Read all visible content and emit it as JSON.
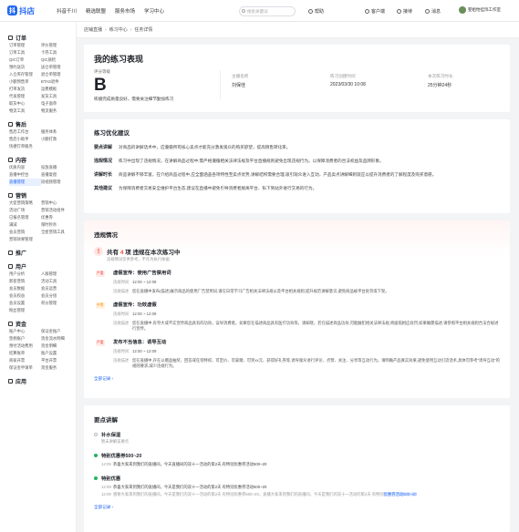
{
  "topbar": {
    "logo_text": "抖店",
    "nav": [
      "抖音千川",
      "精选联盟",
      "服务市场",
      "学习中心"
    ],
    "search_placeholder": "搜索关键词",
    "tools": [
      "帮助",
      "客户端",
      "接待",
      "消息"
    ],
    "user_name": "婴姐怡挂饰工作室"
  },
  "sidebar": [
    {
      "title": "订单",
      "items": [
        "订单管理",
        "评价管理",
        "订单工具",
        "卡券工具",
        "QIC订单",
        "QIC质检",
        "预约送货",
        "送仓单管理",
        "入仓库存管理",
        "退仓单管理",
        "小额预售单",
        "BTAS退件",
        "打单发货",
        "运费模板",
        "代发管理",
        "发货工具",
        "取货中心",
        "电子面单",
        "物流工具",
        "物流服务"
      ]
    },
    {
      "title": "售后",
      "items": [
        "售后工作台",
        "服务体系",
        "售后小助手",
        "小额打款",
        "快捷钉单服务"
      ]
    },
    {
      "title": "内容",
      "items": [
        "优质内容",
        "投放直播",
        "直播中控台",
        "直播复盘",
        "直播管理",
        "短视频管理"
      ]
    },
    {
      "title": "营销",
      "items": [
        "大促营销策略",
        "营销中心",
        "活动广场",
        "营销活动组件",
        "已报名管理",
        "优惠券",
        "满减",
        "限时秒杀",
        "会员营销",
        "全屋营销工具",
        "营销效果管理"
      ]
    },
    {
      "title": "推广",
      "items": []
    },
    {
      "title": "用户",
      "items": [
        "用户分析",
        "人群管理",
        "新客营销",
        "活动工具",
        "会员数据",
        "会员运营",
        "会员权益",
        "会员分组",
        "会员设置",
        "积分管理",
        "粉丝管理"
      ]
    },
    {
      "title": "资金",
      "items": [
        "账户中心",
        "保证金账户",
        "垫佣账户",
        "资金流水明细",
        "预付活动费用",
        "资金明细",
        "结算账单",
        "账户设置",
        "商家开票",
        "平台开票",
        "保证金申请单",
        "资金服务"
      ]
    },
    {
      "title": "应用",
      "items": []
    }
  ],
  "active_sidebar_item": "直播管理",
  "breadcrumb": [
    "店铺直播",
    "练习中心",
    "任务详情"
  ],
  "summary": {
    "title": "我的练习表现",
    "grade_label": "评分等级",
    "grade": "B",
    "grade_desc": "练播完成质量良好，需要关注细节勤加练习",
    "anchor_label": "主播名称",
    "anchor": "刘保佳",
    "time_label": "练习创建时间",
    "time": "2023/03/30 10:08",
    "duration_label": "本次练习时长",
    "duration": "25分钟24秒"
  },
  "suggestions": {
    "title": "练习优化建议",
    "items": [
      {
        "k": "要点讲解",
        "v": "对商品的讲解话术中，应遵循所有核心卖点才能充分激发观众的购买欲望，提高销售转化率。"
      },
      {
        "k": "违规情况",
        "v": "练习中出现了违规情况，在讲解商品过程中,需严格遵循相关法律法规及平台直播规则避免出现违规行为。以保障消费者的合法权益及品牌形象。"
      },
      {
        "k": "讲解时长",
        "v": "商品讲解不够丰富，在介绍商品过程中,应全面涵盖各项特性至卖点优势,讲解结构需要合理,吸引观众进入互动，产品卖点讲解细则就应以提升消费者的了解程度及购买意愿。"
      },
      {
        "k": "其他建议",
        "v": "为保障消费者交易安全维护平台生态,建议在直播中避免引导消费者脱离平台、私下到站外进行交易的行为。"
      }
    ]
  },
  "violations": {
    "title": "违规情况",
    "count_prefix": "共有",
    "count": "4",
    "count_suffix": "项 违规在本次练习中",
    "sub": "违规情况仅供参考，不作为执行依据",
    "items": [
      {
        "tag": "严重",
        "title": "虚假宣传：使用广告禁用词",
        "time": "12:00 ~ 12:09",
        "text": "您在直播中发布(描述)展示商品的使用广告禁用词,请在日常学习广告相关法律法规以及平台相关规则,提升规范讲解意识,避免商品被平台处罚或下架。"
      },
      {
        "tag": "中等",
        "title": "虚假宣传：功效虚假",
        "time": "12:00 ~ 12:09",
        "text": "您在直播中,有夸大或不实宣传商品具有的功效，误导消费者。如果您在描述商品具有医疗功效等，请知晓，若在描述商品功效,可能触犯相关法律法规,将面临相应处罚;如果确需描述,请参照平台相关规则合法合规进行宣传。"
      },
      {
        "tag": "严重",
        "title": "发布不当信息：诱导互动",
        "time": "12:00 ~ 12:09",
        "text": "您在直播中,存在以赠品抽奖、回答或任何特权、可定价、可拿赠、可奖xx元、获得好礼券等,诱导观众进行评论、点赞、关注、分享等互动行为。请明确产品真实效果,避免使用互动引流话术,具体可参考“诱导互动”的规则要求,减少违规行为。"
      }
    ],
    "more": "全部记录"
  },
  "key_points": {
    "title": "要点讲解",
    "items": [
      {
        "title": "补水保湿",
        "sub": "暂未讲解该要点",
        "ok": false,
        "rows": []
      },
      {
        "title": "特别优惠券500~20",
        "sub": "",
        "ok": true,
        "rows": [
          {
            "t": "12:09",
            "s": "恭喜大家来到我们的直播间，今天直播间的双十一活动的第2天,有特别优惠券活动500~20",
            "hl": ""
          }
        ]
      },
      {
        "title": "特别优惠",
        "sub": "",
        "ok": true,
        "rows": [
          {
            "t": "12:09",
            "s": "恭喜大家来到我们的直播间，今天是我们的双十一活动的第2天 有特别优惠券活动500~20",
            "hl": ""
          },
          {
            "t": "12:09",
            "s": "感谢大家来到我们的直播间，今天是我们的双十一活动的第2天 有特别优惠券500~20，直播大家来到我们的直播间，今天是我们的双十一活动的第2天 有特别",
            "hl": "优惠券活动500~20"
          }
        ]
      }
    ],
    "more": "全部记录"
  }
}
